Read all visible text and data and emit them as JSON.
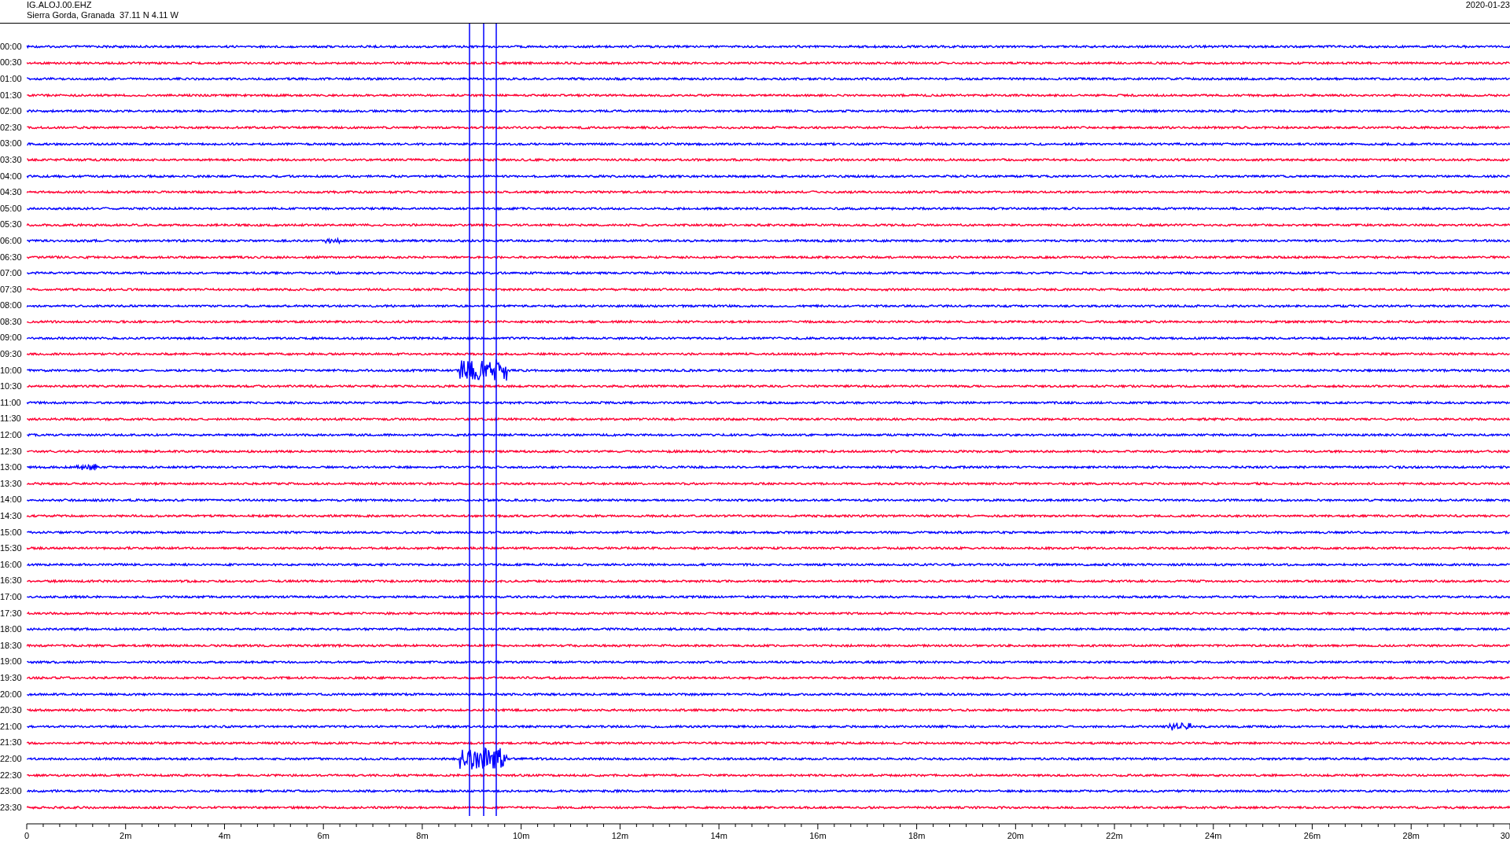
{
  "header": {
    "station": "IG.ALOJ.00.EHZ",
    "location": "Sierra Gorda, Granada  37.11 N 4.11 W",
    "date": "2020-01-23"
  },
  "traces": [
    {
      "label": "00:00",
      "color": "#0000ff"
    },
    {
      "label": "00:30",
      "color": "#ff0033"
    },
    {
      "label": "01:00",
      "color": "#0000ff"
    },
    {
      "label": "01:30",
      "color": "#ff0033"
    },
    {
      "label": "02:00",
      "color": "#0000ff"
    },
    {
      "label": "02:30",
      "color": "#ff0033"
    },
    {
      "label": "03:00",
      "color": "#0000ff"
    },
    {
      "label": "03:30",
      "color": "#ff0033"
    },
    {
      "label": "04:00",
      "color": "#0000ff"
    },
    {
      "label": "04:30",
      "color": "#ff0033"
    },
    {
      "label": "05:00",
      "color": "#0000ff"
    },
    {
      "label": "05:30",
      "color": "#ff0033"
    },
    {
      "label": "06:00",
      "color": "#0000ff"
    },
    {
      "label": "06:30",
      "color": "#ff0033"
    },
    {
      "label": "07:00",
      "color": "#0000ff"
    },
    {
      "label": "07:30",
      "color": "#ff0033"
    },
    {
      "label": "08:00",
      "color": "#0000ff"
    },
    {
      "label": "08:30",
      "color": "#ff0033"
    },
    {
      "label": "09:00",
      "color": "#0000ff"
    },
    {
      "label": "09:30",
      "color": "#ff0033"
    },
    {
      "label": "10:00",
      "color": "#0000ff"
    },
    {
      "label": "10:30",
      "color": "#ff0033"
    },
    {
      "label": "11:00",
      "color": "#0000ff"
    },
    {
      "label": "11:30",
      "color": "#ff0033"
    },
    {
      "label": "12:00",
      "color": "#0000ff"
    },
    {
      "label": "12:30",
      "color": "#ff0033"
    },
    {
      "label": "13:00",
      "color": "#0000ff"
    },
    {
      "label": "13:30",
      "color": "#ff0033"
    },
    {
      "label": "14:00",
      "color": "#0000ff"
    },
    {
      "label": "14:30",
      "color": "#ff0033"
    },
    {
      "label": "15:00",
      "color": "#0000ff"
    },
    {
      "label": "15:30",
      "color": "#ff0033"
    },
    {
      "label": "16:00",
      "color": "#0000ff"
    },
    {
      "label": "16:30",
      "color": "#ff0033"
    },
    {
      "label": "17:00",
      "color": "#0000ff"
    },
    {
      "label": "17:30",
      "color": "#ff0033"
    },
    {
      "label": "18:00",
      "color": "#0000ff"
    },
    {
      "label": "18:30",
      "color": "#ff0033"
    },
    {
      "label": "19:00",
      "color": "#0000ff"
    },
    {
      "label": "19:30",
      "color": "#ff0033"
    },
    {
      "label": "20:00",
      "color": "#0000ff"
    },
    {
      "label": "20:30",
      "color": "#ff0033"
    },
    {
      "label": "21:00",
      "color": "#0000ff"
    },
    {
      "label": "21:30",
      "color": "#ff0033"
    },
    {
      "label": "22:00",
      "color": "#0000ff"
    },
    {
      "label": "22:30",
      "color": "#ff0033"
    },
    {
      "label": "23:00",
      "color": "#0000ff"
    },
    {
      "label": "23:30",
      "color": "#ff0033"
    }
  ],
  "x_axis": {
    "ticks": [
      "0",
      "2m",
      "4m",
      "6m",
      "8m",
      "10m",
      "12m",
      "14m",
      "16m",
      "18m",
      "20m",
      "22m",
      "24m",
      "26m",
      "28m",
      "30"
    ]
  }
}
